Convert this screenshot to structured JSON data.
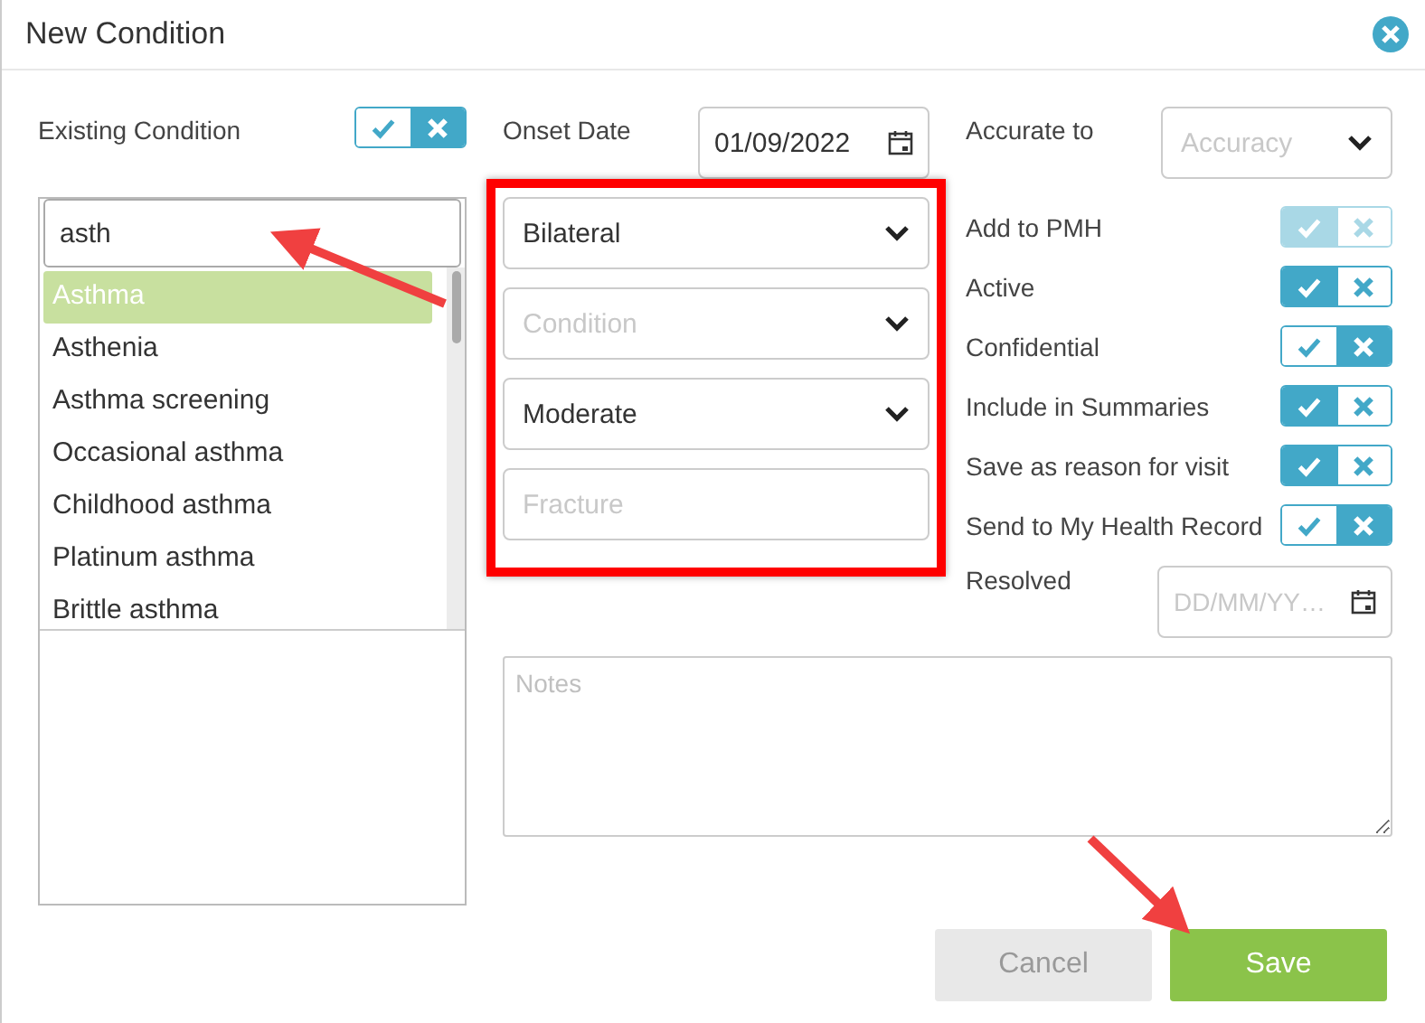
{
  "dialog": {
    "title": "New Condition"
  },
  "existing_condition": {
    "label": "Existing Condition",
    "on": false
  },
  "search": {
    "value": "asth"
  },
  "suggestions": [
    {
      "label": "Asthma",
      "selected": true
    },
    {
      "label": "Asthenia",
      "selected": false
    },
    {
      "label": "Asthma screening",
      "selected": false
    },
    {
      "label": "Occasional asthma",
      "selected": false
    },
    {
      "label": "Childhood asthma",
      "selected": false
    },
    {
      "label": "Platinum asthma",
      "selected": false
    },
    {
      "label": "Brittle asthma",
      "selected": false
    }
  ],
  "onset_date": {
    "label": "Onset Date",
    "value": "01/09/2022"
  },
  "detail_fields": [
    {
      "kind": "select",
      "value": "Bilateral"
    },
    {
      "kind": "select",
      "placeholder": "Condition"
    },
    {
      "kind": "select",
      "value": "Moderate"
    },
    {
      "kind": "text",
      "placeholder": "Fracture"
    }
  ],
  "accurate_to": {
    "label": "Accurate to",
    "placeholder": "Accuracy"
  },
  "options": [
    {
      "label": "Add to PMH",
      "on": true,
      "disabled": true
    },
    {
      "label": "Active",
      "on": true,
      "disabled": false
    },
    {
      "label": "Confidential",
      "on": false,
      "disabled": false
    },
    {
      "label": "Include in Summaries",
      "on": true,
      "disabled": false
    },
    {
      "label": "Save as reason for visit",
      "on": true,
      "disabled": false
    },
    {
      "label": "Send to My Health Record",
      "on": false,
      "disabled": false
    }
  ],
  "resolved": {
    "label": "Resolved",
    "placeholder": "DD/MM/YY…"
  },
  "notes": {
    "placeholder": "Notes"
  },
  "buttons": [
    {
      "label": "Cancel",
      "kind": "secondary"
    },
    {
      "label": "Save",
      "kind": "primary"
    }
  ]
}
